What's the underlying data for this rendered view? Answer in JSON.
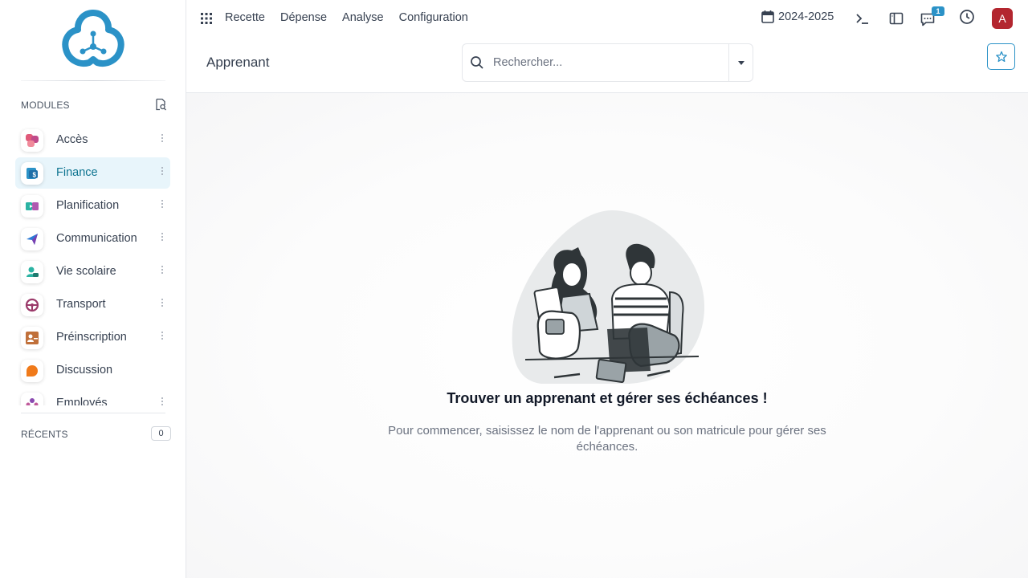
{
  "sidebar": {
    "modules_label": "MODULES",
    "recent_label": "RÉCENTS",
    "recent_count": "0",
    "items": [
      {
        "label": "Accès",
        "icon": "access-icon",
        "active": false
      },
      {
        "label": "Finance",
        "icon": "finance-icon",
        "active": true
      },
      {
        "label": "Planification",
        "icon": "planning-icon",
        "active": false
      },
      {
        "label": "Communication",
        "icon": "paper-plane-icon",
        "active": false
      },
      {
        "label": "Vie scolaire",
        "icon": "school-life-icon",
        "active": false
      },
      {
        "label": "Transport",
        "icon": "steering-wheel-icon",
        "active": false
      },
      {
        "label": "Préinscription",
        "icon": "preregistration-icon",
        "active": false
      },
      {
        "label": "Discussion",
        "icon": "chat-bubble-icon",
        "active": false
      },
      {
        "label": "Employés",
        "icon": "employees-icon",
        "active": false
      }
    ]
  },
  "topbar": {
    "menu": [
      "Recette",
      "Dépense",
      "Analyse",
      "Configuration"
    ],
    "year": "2024-2025",
    "chat_badge": "1",
    "avatar_letter": "A",
    "avatar_color": "#b3262f",
    "accent_color": "#2b92c7"
  },
  "control_panel": {
    "title": "Apprenant",
    "search_placeholder": "Rechercher..."
  },
  "helper": {
    "title": "Trouver un apprenant et gérer ses échéances !",
    "text": "Pour commencer, saisissez le nom de l'apprenant ou son matricule pour gérer ses échéances."
  }
}
